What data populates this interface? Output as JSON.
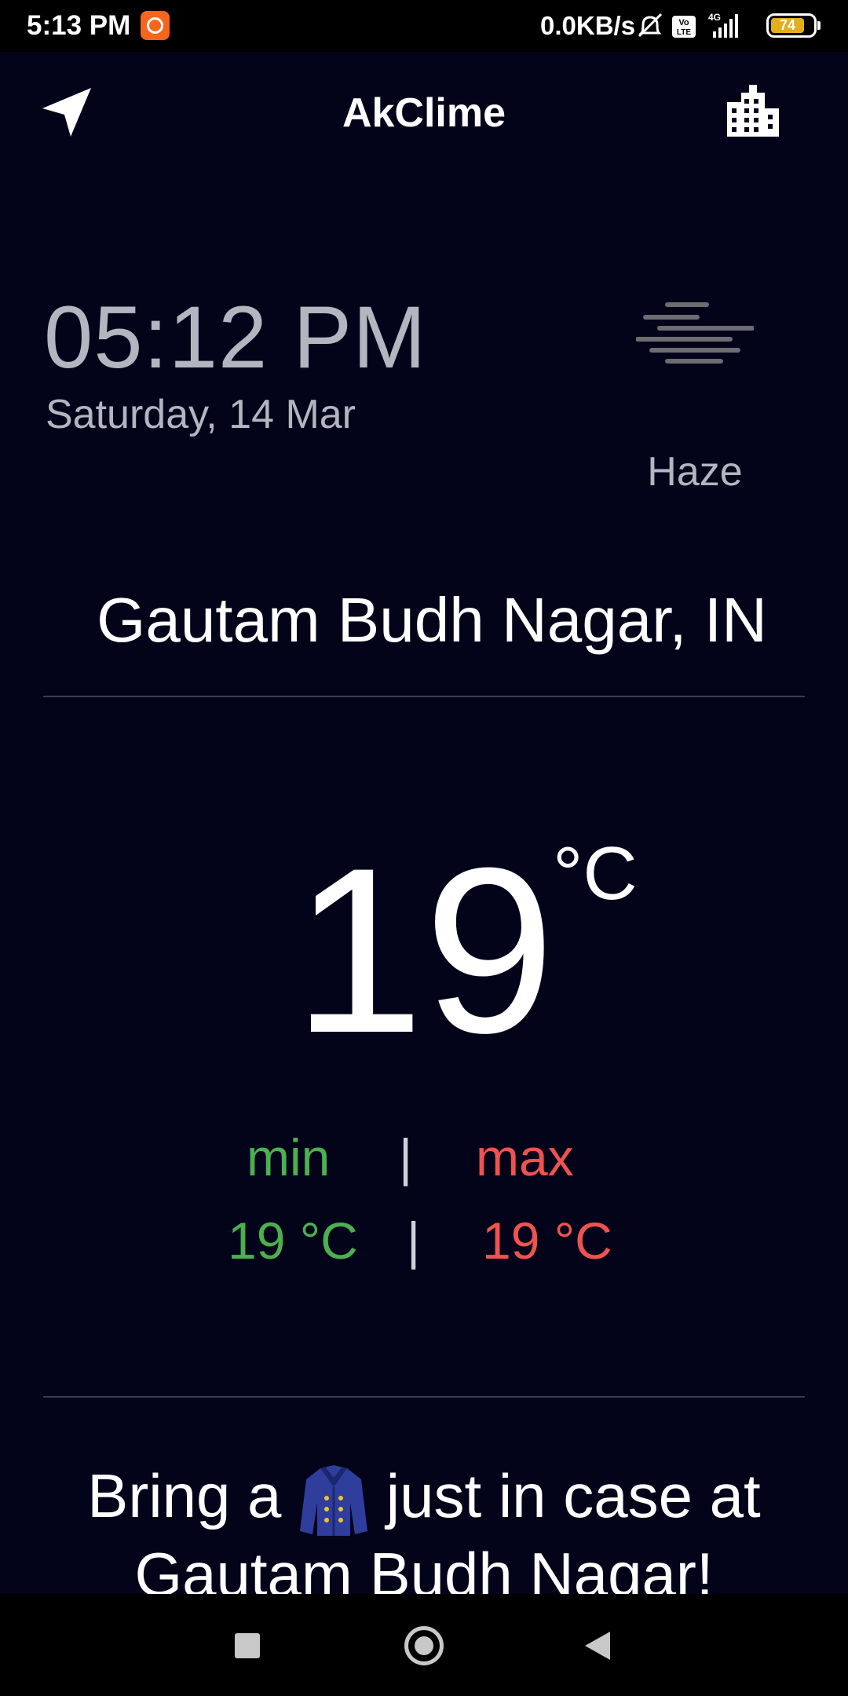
{
  "status_bar": {
    "time": "5:13 PM",
    "network_speed": "0.0KB/s",
    "network_type": "4G",
    "volte": "Vo LTE",
    "battery_level": "74",
    "battery_color": "#e4ad1a"
  },
  "app_bar": {
    "title": "AkClime",
    "left_icon": "navigation-arrow-icon",
    "right_icon": "city-buildings-icon"
  },
  "clock": {
    "time": "05:12 PM",
    "date": "Saturday, 14 Mar"
  },
  "condition": {
    "icon": "haze-icon",
    "label": "Haze"
  },
  "location": "Gautam Budh Nagar, IN",
  "temperature": {
    "value": "19",
    "unit": "°C"
  },
  "range": {
    "min_label": "min",
    "max_label": "max",
    "separator": "|",
    "min_value": "19 °C",
    "max_value": "19 °C",
    "min_color": "#4caf50",
    "max_color": "#ef5350"
  },
  "suggestion": {
    "prefix": "Bring a",
    "icon": "coat-emoji-icon",
    "suffix": "just in case at",
    "line2": "Gautam Budh Nagar!"
  },
  "colors": {
    "background": "#03041a",
    "muted_text": "#b3b5bf"
  }
}
